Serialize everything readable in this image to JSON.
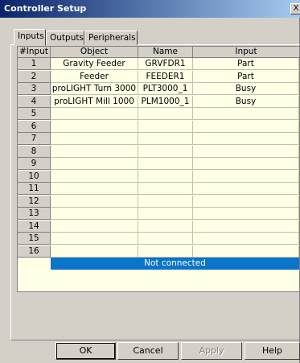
{
  "window": {
    "title": "Controller Setup",
    "close_label": "X"
  },
  "tabs": [
    {
      "label": "Inputs"
    },
    {
      "label": "Outputs"
    },
    {
      "label": "Peripherals"
    }
  ],
  "table": {
    "columns": [
      "#Input",
      "Object",
      "Name",
      "Input"
    ],
    "rows": [
      {
        "num": "1",
        "object": "Gravity Feeder",
        "name": "GRVFDR1",
        "input": "Part"
      },
      {
        "num": "2",
        "object": "Feeder",
        "name": "FEEDER1",
        "input": "Part"
      },
      {
        "num": "3",
        "object": "proLIGHT Turn 3000",
        "name": "PLT3000_1",
        "input": "Busy"
      },
      {
        "num": "4",
        "object": "proLIGHT Mill 1000",
        "name": "PLM1000_1",
        "input": "Busy"
      },
      {
        "num": "5",
        "object": "",
        "name": "",
        "input": ""
      },
      {
        "num": "6",
        "object": "",
        "name": "",
        "input": ""
      },
      {
        "num": "7",
        "object": "",
        "name": "",
        "input": ""
      },
      {
        "num": "8",
        "object": "",
        "name": "",
        "input": ""
      },
      {
        "num": "9",
        "object": "",
        "name": "",
        "input": ""
      },
      {
        "num": "10",
        "object": "",
        "name": "",
        "input": ""
      },
      {
        "num": "11",
        "object": "",
        "name": "",
        "input": ""
      },
      {
        "num": "12",
        "object": "",
        "name": "",
        "input": ""
      },
      {
        "num": "13",
        "object": "",
        "name": "",
        "input": ""
      },
      {
        "num": "14",
        "object": "",
        "name": "",
        "input": ""
      },
      {
        "num": "15",
        "object": "",
        "name": "",
        "input": ""
      },
      {
        "num": "16",
        "object": "",
        "name": "",
        "input": ""
      }
    ],
    "status": "Not connected"
  },
  "buttons": {
    "ok": "OK",
    "cancel": "Cancel",
    "apply": "Apply",
    "help": "Help"
  },
  "colors": {
    "title_bar": "#0a246a",
    "status_bar": "#0a74c8",
    "grid_background": "#ffffe6",
    "dialog_face": "#d4d0c8"
  }
}
